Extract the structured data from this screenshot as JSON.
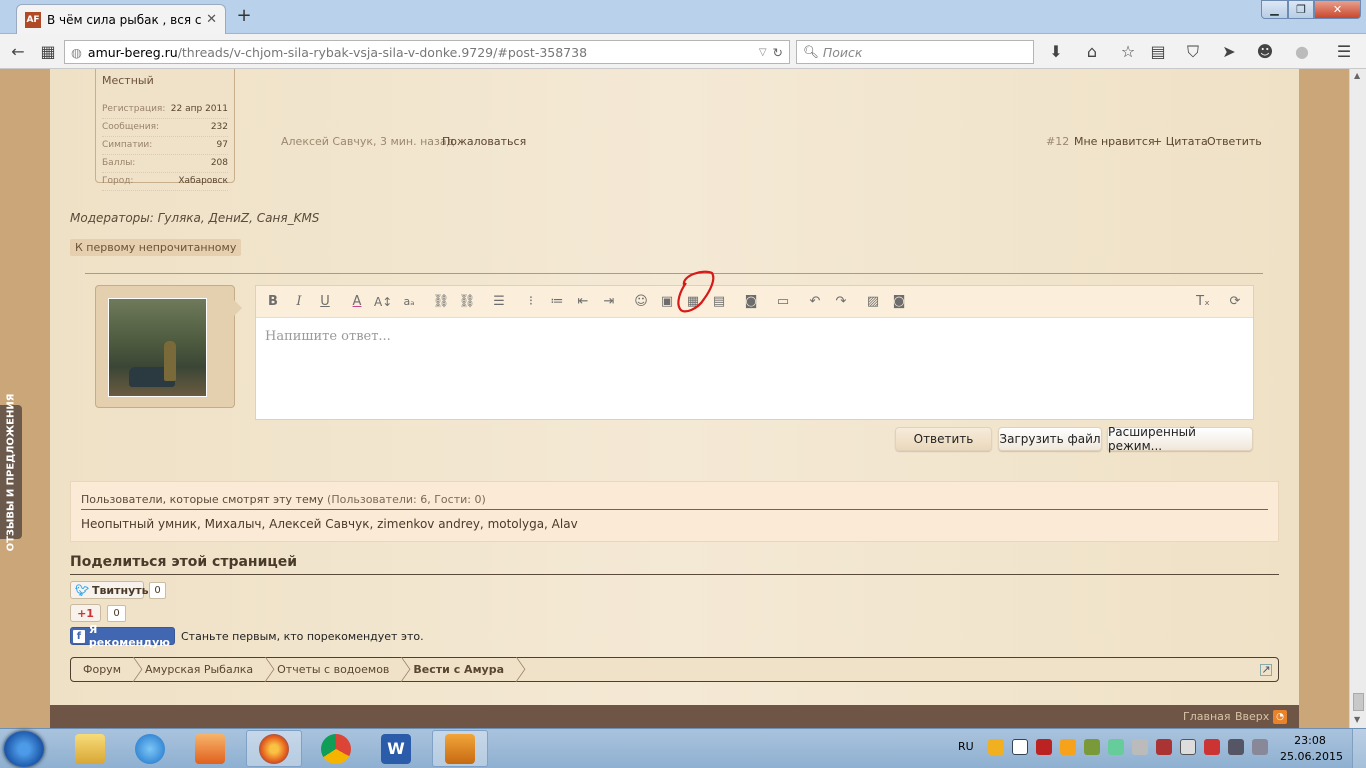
{
  "browser": {
    "tab_title": "В чём сила рыбак , вся си...",
    "tab_favicon": "AF",
    "url_host": "amur-bereg.ru",
    "url_path": "/threads/v-chjom-sila-rybak-vsja-sila-v-donke.9729/#post-358738",
    "search_placeholder": "Поиск"
  },
  "feedback_tab": "ОТЗЫВЫ И ПРЕДЛОЖЕНИЯ",
  "usercard": {
    "rank": "Местный",
    "stats": [
      {
        "label": "Регистрация:",
        "value": "22 апр 2011"
      },
      {
        "label": "Сообщения:",
        "value": "232"
      },
      {
        "label": "Симпатии:",
        "value": "97"
      },
      {
        "label": "Баллы:",
        "value": "208"
      },
      {
        "label": "Город:",
        "value": "Хабаровск"
      }
    ]
  },
  "post_meta": {
    "author_time": "Алексей Савчук, 3 мин. назад",
    "report": "Пожаловаться",
    "number": "#12",
    "like": "Мне нравится",
    "quote": "+ Цитата",
    "reply": "Ответить"
  },
  "moderators": "Модераторы: Гуляка, ДениZ, Саня_KMS",
  "first_unread": "К первому непрочитанному",
  "editor": {
    "placeholder": "Напишите ответ...",
    "toolbar_icons": [
      "bold-icon",
      "italic-icon",
      "underline-icon",
      "text-color-icon",
      "font-size-icon",
      "font-family-icon",
      "link-icon",
      "unlink-icon",
      "align-icon",
      "bullet-list-icon",
      "numbered-list-icon",
      "outdent-icon",
      "indent-icon",
      "smiley-icon",
      "image-icon",
      "media-icon",
      "insert-more-icon",
      "camera-icon",
      "save-draft-icon",
      "undo-icon",
      "redo-icon",
      "gallery-icon",
      "screenshot-icon",
      "remove-format-icon",
      "toggle-bbcode-icon"
    ]
  },
  "buttons": {
    "reply": "Ответить",
    "upload": "Загрузить файл",
    "advanced": "Расширенный режим..."
  },
  "watchers": {
    "title": "Пользователи, которые смотрят эту тему",
    "counts": "(Пользователи: 6, Гости: 0)",
    "names": "Неопытный умник, Михалыч, Алексей Савчук, zimenkov andrey, motolyga, Alav"
  },
  "share": {
    "title": "Поделиться этой страницей",
    "tweet": "Твитнуть",
    "tweet_count": "0",
    "gplus": "+1",
    "gplus_count": "0",
    "fb_recommend": "Я рекомендую",
    "fb_text": "Станьте первым, кто порекомендует это."
  },
  "breadcrumb": [
    "Форум",
    "Амурская Рыбалка",
    "Отчеты с водоемов",
    "Вести с Амура"
  ],
  "footer": {
    "home": "Главная",
    "top": "Вверх"
  },
  "taskbar": {
    "lang": "RU",
    "time": "23:08",
    "date": "25.06.2015"
  },
  "colors": {
    "page_bg": "#f2e6cf",
    "footer_bg": "#6e5546",
    "annotation_red": "#d61a1a"
  }
}
